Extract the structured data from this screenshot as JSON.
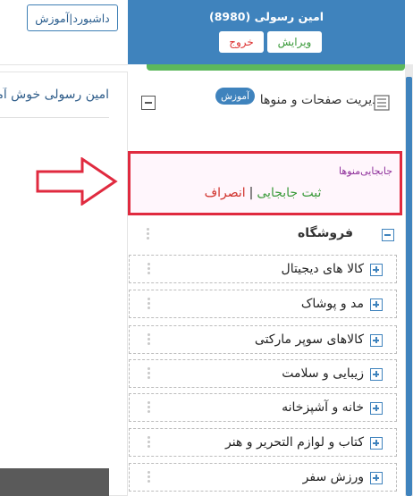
{
  "top_left": {
    "dashboard_label": "داشبورد|آموزش"
  },
  "left_panel": {
    "welcome_text": "امین رسولی خوش آمدید"
  },
  "header": {
    "user_name": "امین رسولی (8980)",
    "edit_label": "ویرایش",
    "exit_label": "خروج"
  },
  "menu_manager": {
    "title": "مدیریت صفحات و منوها",
    "tutorial_badge": "آموزش"
  },
  "move_box": {
    "label": "جابجایی‌منوها",
    "save_label": "ثبت جابجایی",
    "separator": "|",
    "cancel_label": "انصراف"
  },
  "shop": {
    "label": "فروشگاه"
  },
  "categories": [
    {
      "label": "کالا های دیجیتال"
    },
    {
      "label": "مد و پوشاک"
    },
    {
      "label": "کالاهای سوپر مارکتی"
    },
    {
      "label": "زیبایی و سلامت"
    },
    {
      "label": "خانه و آشپزخانه"
    },
    {
      "label": "کتاب و لوازم التحریر و هنر"
    },
    {
      "label": "ورزش سفر"
    }
  ],
  "colors": {
    "header_blue": "#3f83bd",
    "highlight_red": "#e02a3f",
    "green": "#5cb85c"
  }
}
